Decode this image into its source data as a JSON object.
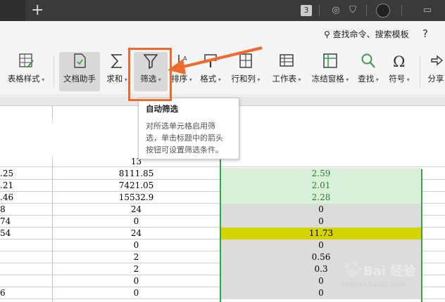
{
  "titlebar": {
    "badge": "3"
  },
  "menubar": {
    "search_label": "查找命令、搜索模板",
    "help_label": "?"
  },
  "ribbon": {
    "items": [
      {
        "label": "表格样式"
      },
      {
        "label": "文档助手"
      },
      {
        "label": "求和"
      },
      {
        "label": "筛选"
      },
      {
        "label": "排序"
      },
      {
        "label": "格式"
      },
      {
        "label": "行和列"
      },
      {
        "label": "工作表"
      },
      {
        "label": "冻结窗格"
      },
      {
        "label": "查找"
      },
      {
        "label": "符号"
      },
      {
        "label": "分享"
      }
    ]
  },
  "tooltip": {
    "title": "自动筛选",
    "line1": "对所选单元格启用筛",
    "line2": "选，单击标题中的箭头",
    "line3": "按钮可设置筛选条件。"
  },
  "table": {
    "partial_row": {
      "b": "13"
    },
    "rows": [
      {
        "a": ".25",
        "b": "8111.85",
        "c": "2.59",
        "c_style": "green"
      },
      {
        "a": ".21",
        "b": "7421.05",
        "c": "2.01",
        "c_style": "green"
      },
      {
        "a": ".46",
        "b": "15532.9",
        "c": "2.28",
        "c_style": "green"
      },
      {
        "a": "8",
        "b": "24",
        "c": "0",
        "c_style": "gray"
      },
      {
        "a": "74",
        "b": "0",
        "c": "0",
        "c_style": "gray"
      },
      {
        "a": "54",
        "b": "24",
        "c": "11.73",
        "c_style": "yellow"
      },
      {
        "a": "",
        "b": "0",
        "c": "0",
        "c_style": "gray"
      },
      {
        "a": "",
        "b": "2",
        "c": "0.56",
        "c_style": "gray"
      },
      {
        "a": "",
        "b": "2",
        "c": "0.3",
        "c_style": "gray"
      },
      {
        "a": "",
        "b": "0",
        "c": "0",
        "c_style": "gray"
      },
      {
        "a": "6",
        "b": "0",
        "c": "0",
        "c_style": "gray"
      }
    ]
  },
  "watermark": {
    "brand": "Bai 经验",
    "url": "jingyan.baidu.com"
  },
  "colors": {
    "accent_orange": "#f06a2e",
    "green_border": "#3aa04a",
    "yellow_cell": "#d4d400",
    "green_cell": "#d9f0d9"
  }
}
